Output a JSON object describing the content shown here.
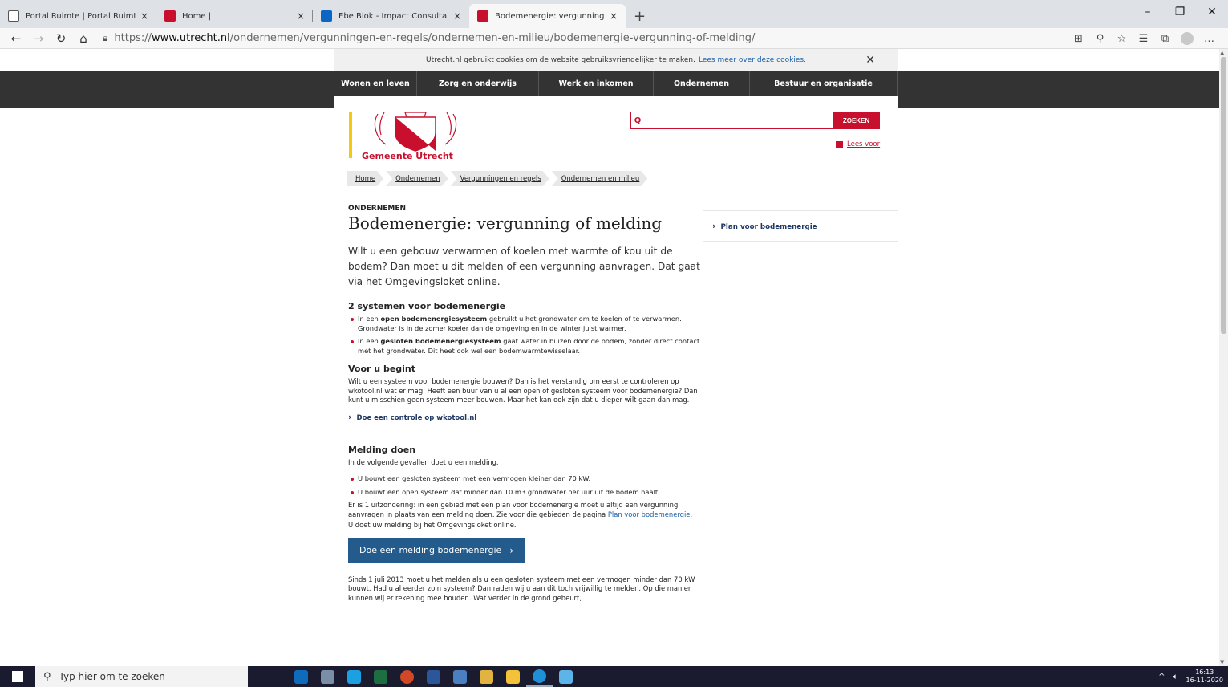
{
  "browser": {
    "tabs": [
      {
        "title": "Portal Ruimte | Portal Ruimte",
        "favicon_color": "#ffffff",
        "active": false
      },
      {
        "title": "Home |",
        "favicon_color": "#c8102e",
        "active": false
      },
      {
        "title": "Ebe Blok - Impact Consultant - S",
        "favicon_color": "#0a66c2",
        "active": false
      },
      {
        "title": "Bodemenergie: vergunning of m",
        "favicon_color": "#c8102e",
        "active": true
      }
    ],
    "new_tab": "+",
    "close_glyph": "×",
    "window_controls": [
      "–",
      "❐",
      "✕"
    ],
    "nav": {
      "back": "←",
      "forward": "→",
      "refresh": "↻",
      "home": "⌂"
    },
    "url_prefix": "https://",
    "url_domain": "www.utrecht.nl",
    "url_path": "/ondernemen/vergunningen-en-regels/ondernemen-en-milieu/bodemenergie-vergunning-of-melding/",
    "toolbar_icons": [
      "⊞",
      "⚲",
      "☆",
      "☰",
      "⧉",
      "…"
    ]
  },
  "cookie": {
    "text": "Utrecht.nl gebruikt cookies om de website gebruiksvriendelijker te maken.",
    "link": "Lees meer over deze cookies.",
    "close": "✕"
  },
  "mainnav": [
    {
      "label": "Wonen en leven",
      "width": 103
    },
    {
      "label": "Zorg en onderwijs",
      "width": 152
    },
    {
      "label": "Werk en inkomen",
      "width": 143
    },
    {
      "label": "Ondernemen",
      "width": 120
    },
    {
      "label": "Bestuur en organisatie",
      "width": 184
    }
  ],
  "logo": {
    "text": "Gemeente Utrecht"
  },
  "search": {
    "placeholder": "",
    "button": "ZOEKEN",
    "icon": "Q"
  },
  "leesvoor": "Lees voor",
  "breadcrumbs": [
    "Home",
    "Ondernemen",
    "Vergunningen en regels",
    "Ondernemen en milieu"
  ],
  "article": {
    "kicker": "ONDERNEMEN",
    "title": "Bodemenergie: vergunning of melding",
    "intro": "Wilt u een gebouw verwarmen of koelen met warmte of kou uit de bodem? Dan moet u dit melden of een vergunning aanvragen. Dat gaat via het Omgevingsloket online.",
    "s1_title": "2 systemen voor bodemenergie",
    "s1_b1_pre": "In een",
    "s1_b1_bold": "open bodemenergiesysteem",
    "s1_b1_post": "gebruikt u het grondwater om te koelen of te verwarmen. Grondwater is in de zomer koeler dan de omgeving en in de winter juist warmer.",
    "s1_b2_pre": "In een",
    "s1_b2_bold": "gesloten bodemenergiesysteem",
    "s1_b2_post": "gaat water in buizen door de bodem, zonder direct contact met het grondwater. Dit heet ook wel een bodemwarmtewisselaar.",
    "s2_title": "Voor u begint",
    "s2_text": "Wilt u een systeem voor bodemenergie bouwen? Dan is het verstandig om eerst te controleren op wkotool.nl wat er mag. Heeft een buur van u al een open of gesloten systeem voor bodemenergie? Dan kunt u misschien geen systeem meer bouwen. Maar het kan ook zijn dat u dieper wilt gaan dan mag.",
    "s2_link": "Doe een controle op wkotool.nl",
    "s3_title": "Melding doen",
    "s3_text": "In de volgende gevallen doet u een melding.",
    "s3_b1": "U bouwt een gesloten systeem met een vermogen kleiner dan 70 kW.",
    "s3_b2": "U bouwt een open systeem dat minder dan 10 m3 grondwater per uur uit de bodem haalt.",
    "s3_p2_pre": "Er is 1 uitzondering: in een gebied met een plan voor bodemenergie moet u altijd een vergunning aanvragen in plaats van een melding doen. Zie voor die gebieden de pagina",
    "s3_p2_link": "Plan voor bodemenergie",
    "s3_p2_post": ".",
    "s3_p3": "U doet uw melding bij het Omgevingsloket online.",
    "button": "Doe een melding bodemenergie",
    "button_chevron": "›",
    "s4_text": "Sinds 1 juli 2013 moet u het melden als u een gesloten systeem met een vermogen minder dan 70 kW bouwt. Had u al eerder zo'n systeem? Dan raden wij u aan dit toch vrijwillig te melden. Op die manier kunnen wij er rekening mee houden. Wat verder in de grond gebeurt,"
  },
  "aside": {
    "link": "Plan voor bodemenergie"
  },
  "taskbar": {
    "search_placeholder": "Typ hier om te zoeken",
    "apps": [
      {
        "name": "outlook",
        "color": "#0f6cbd"
      },
      {
        "name": "app2",
        "color": "#7a8fa6"
      },
      {
        "name": "ie",
        "color": "#1ba1e2"
      },
      {
        "name": "excel",
        "color": "#1d6f42"
      },
      {
        "name": "powerpoint",
        "color": "#d24726"
      },
      {
        "name": "word",
        "color": "#2b579a"
      },
      {
        "name": "app7",
        "color": "#4a7fc1"
      },
      {
        "name": "app8",
        "color": "#e3b341"
      },
      {
        "name": "explorer",
        "color": "#f3c13a"
      },
      {
        "name": "edge",
        "color": "#1f8fd6"
      },
      {
        "name": "app11",
        "color": "#5db4e8"
      }
    ],
    "time": "16:13",
    "date": "16-11-2020"
  }
}
